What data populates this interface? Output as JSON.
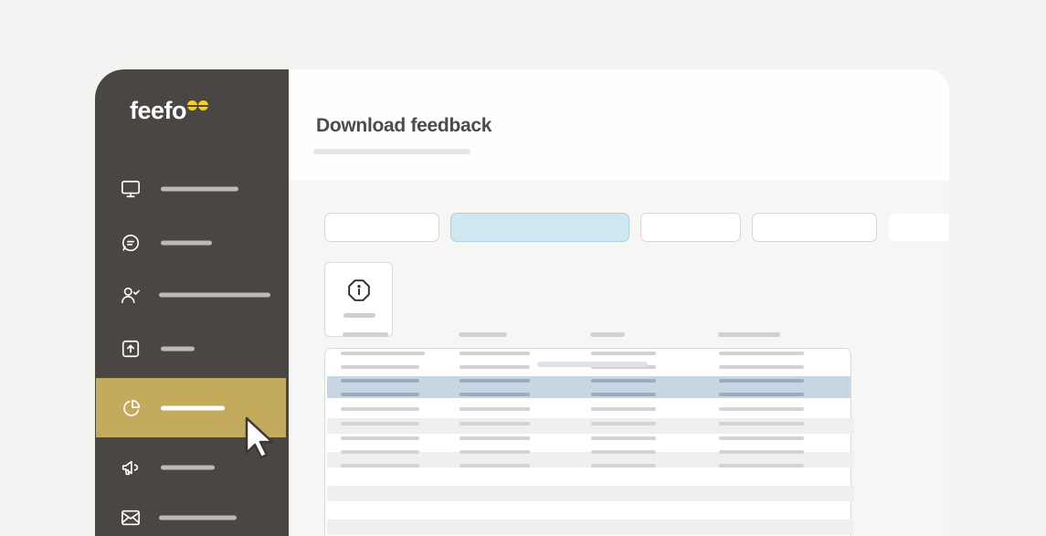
{
  "sidebar": {
    "logo_text": "feefo",
    "logo_accent_color": "#f7d11e",
    "background_color": "#4a4643",
    "active_color": "#c4aa5c",
    "items": [
      {
        "icon": "monitor-icon",
        "active": false
      },
      {
        "icon": "chat-bubble-icon",
        "active": false
      },
      {
        "icon": "user-check-icon",
        "active": false
      },
      {
        "icon": "upload-icon",
        "active": false
      },
      {
        "icon": "pie-chart-icon",
        "active": true
      },
      {
        "icon": "megaphone-icon",
        "active": false
      },
      {
        "icon": "mail-icon",
        "active": false
      }
    ]
  },
  "header": {
    "title": "Download feedback"
  },
  "filters": {
    "selected_color": "#cde8f0",
    "tabs": [
      {
        "selected": false
      },
      {
        "selected": true
      },
      {
        "selected": false
      },
      {
        "selected": false
      },
      {
        "selected": false
      }
    ]
  },
  "info_card": {
    "icon": "info-octagon-icon"
  },
  "table": {
    "selected_row_color": "#c8d5e2"
  }
}
